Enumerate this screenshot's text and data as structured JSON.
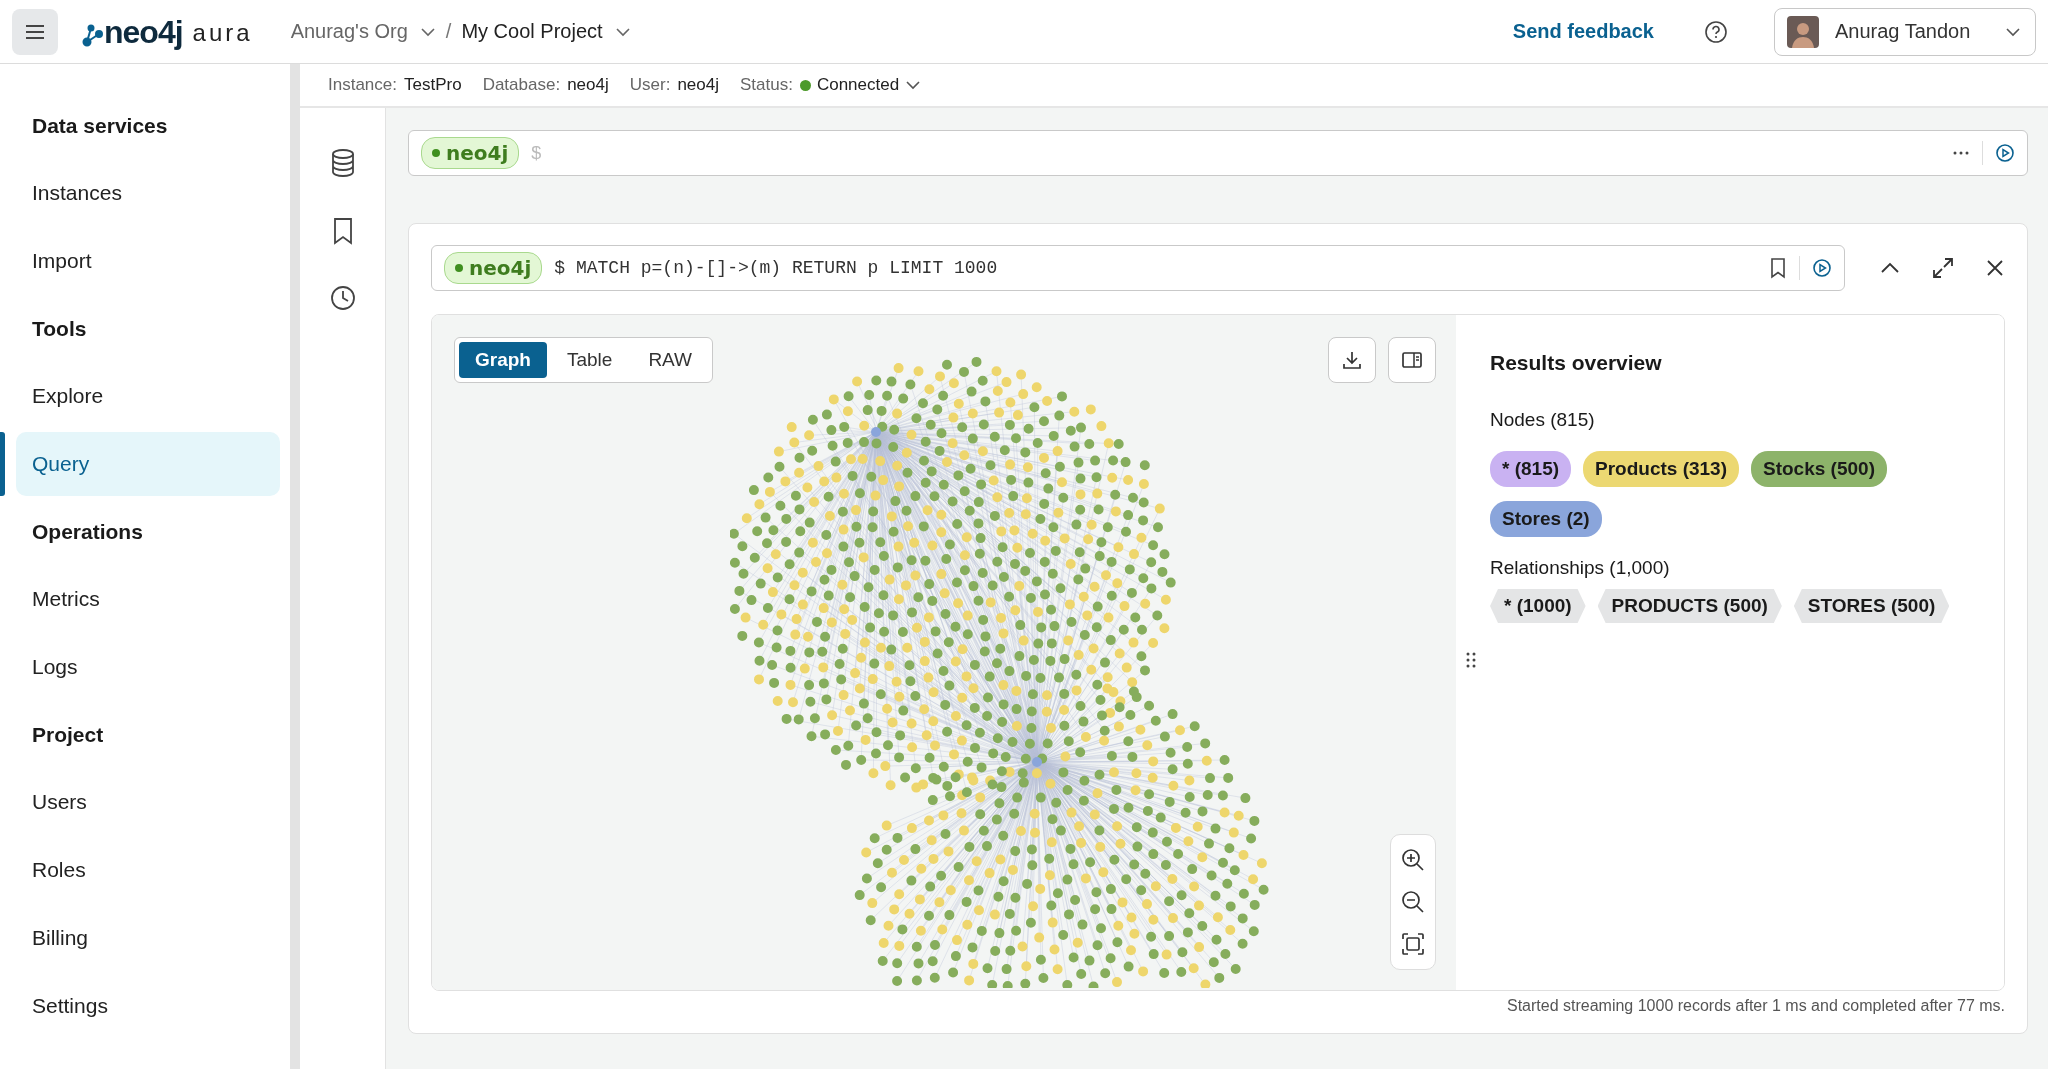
{
  "header": {
    "brand": "neo4j",
    "product": "aura",
    "org": "Anurag's Org",
    "separator": "/",
    "project": "My Cool Project",
    "feedback": "Send feedback",
    "user": "Anurag Tandon"
  },
  "sidebar": {
    "sections": [
      {
        "title": "Data services",
        "items": [
          {
            "label": "Instances",
            "selected": false
          },
          {
            "label": "Import",
            "selected": false
          }
        ]
      },
      {
        "title": "Tools",
        "items": [
          {
            "label": "Explore",
            "selected": false
          },
          {
            "label": "Query",
            "selected": true
          }
        ]
      },
      {
        "title": "Operations",
        "items": [
          {
            "label": "Metrics",
            "selected": false
          },
          {
            "label": "Logs",
            "selected": false
          }
        ]
      },
      {
        "title": "Project",
        "items": [
          {
            "label": "Users",
            "selected": false
          },
          {
            "label": "Roles",
            "selected": false
          },
          {
            "label": "Billing",
            "selected": false
          },
          {
            "label": "Settings",
            "selected": false
          }
        ]
      }
    ]
  },
  "connection": [
    {
      "label": "Instance:",
      "value": "TestPro"
    },
    {
      "label": "Database:",
      "value": "neo4j"
    },
    {
      "label": "User:",
      "value": "neo4j"
    }
  ],
  "status": {
    "label": "Status:",
    "value": "Connected",
    "color": "#4c9a2a"
  },
  "editor": {
    "database": "neo4j",
    "prompt": "$"
  },
  "result": {
    "database": "neo4j",
    "query": "$ MATCH p=(n)-[]->(m) RETURN p LIMIT 1000",
    "tabs": [
      {
        "label": "Graph",
        "selected": true
      },
      {
        "label": "Table",
        "selected": false
      },
      {
        "label": "RAW",
        "selected": false
      }
    ],
    "overview": {
      "title": "Results overview",
      "nodes_heading": "Nodes (815)",
      "node_labels": [
        {
          "label": "* (815)",
          "color": "#c9b2f2"
        },
        {
          "label": "Products (313)",
          "color": "#ecd872"
        },
        {
          "label": "Stocks (500)",
          "color": "#8db36a"
        },
        {
          "label": "Stores (2)",
          "color": "#8aa5db"
        }
      ],
      "relationships_heading": "Relationships (1,000)",
      "relationship_types": [
        {
          "label": "* (1000)"
        },
        {
          "label": "PRODUCTS (500)"
        },
        {
          "label": "STORES (500)"
        }
      ]
    },
    "footer": "Started streaming 1000 records after 1 ms and completed after 77 ms."
  }
}
